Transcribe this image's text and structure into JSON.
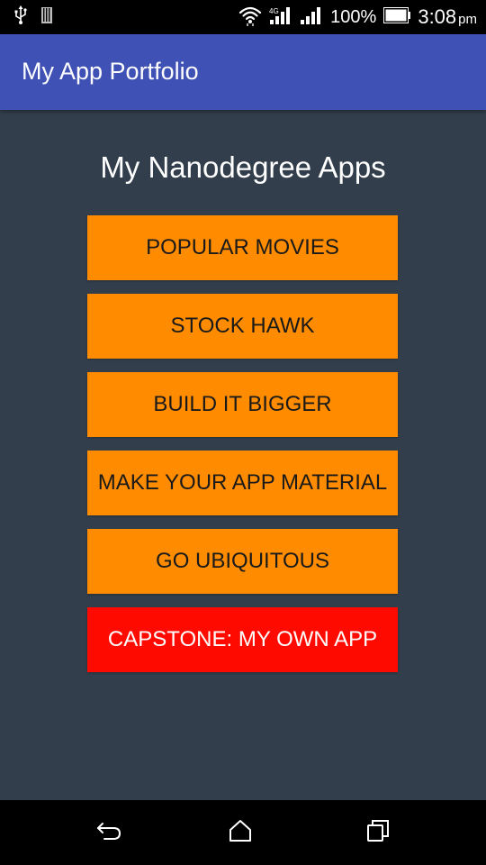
{
  "status_bar": {
    "battery_percent": "100%",
    "time": "3:08",
    "ampm": "pm",
    "icons": [
      "usb-icon",
      "sd-card-icon",
      "wifi-icon",
      "signal-icon",
      "signal-icon",
      "battery-icon"
    ]
  },
  "app_bar": {
    "title": "My App Portfolio",
    "color": "#3F51B5"
  },
  "main": {
    "heading": "My Nanodegree Apps",
    "background": "#323E4B",
    "buttons": [
      {
        "label": "POPULAR MOVIES",
        "color": "#FF8C00"
      },
      {
        "label": "STOCK HAWK",
        "color": "#FF8C00"
      },
      {
        "label": "BUILD IT BIGGER",
        "color": "#FF8C00"
      },
      {
        "label": "MAKE YOUR APP MATERIAL",
        "color": "#FF8C00"
      },
      {
        "label": "GO UBIQUITOUS",
        "color": "#FF8C00"
      },
      {
        "label": "CAPSTONE: MY OWN APP",
        "color": "#FF0A00"
      }
    ]
  },
  "nav_bar": {
    "icons": [
      "back-icon",
      "home-icon",
      "recent-apps-icon"
    ]
  }
}
